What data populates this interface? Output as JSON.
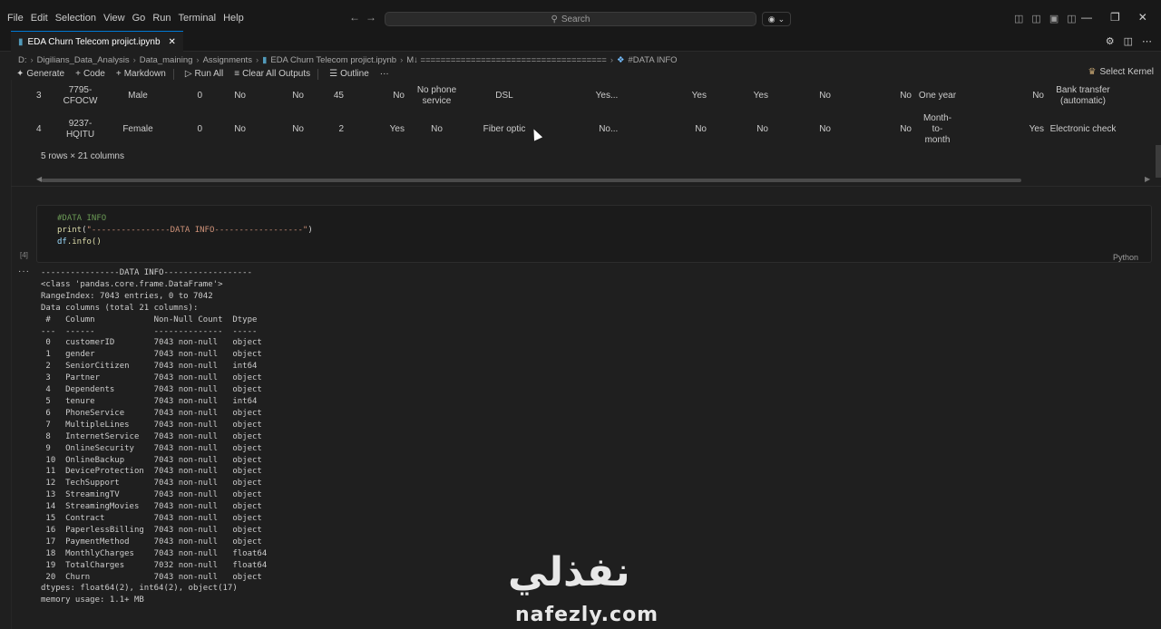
{
  "menu": [
    "File",
    "Edit",
    "Selection",
    "View",
    "Go",
    "Run",
    "Terminal",
    "Help"
  ],
  "search": {
    "placeholder": "Search"
  },
  "tab": {
    "title": "EDA Churn Telecom projict.ipynb"
  },
  "breadcrumb": [
    "D:",
    "Digilians_Data_Analysis",
    "Data_maining",
    "Assignments",
    "EDA Churn Telecom projict.ipynb",
    "M↓ =====================================",
    "#DATA INFO"
  ],
  "toolbar": {
    "generate": "Generate",
    "code": "Code",
    "markdown": "Markdown",
    "run_all": "Run All",
    "clear_outputs": "Clear All Outputs",
    "outline": "Outline",
    "more": "···",
    "select_kernel": "Select Kernel"
  },
  "df_rows": [
    [
      "3",
      "7795-\nCFOCW",
      "Male",
      "0",
      "No",
      "No",
      "45",
      "No",
      "No phone\nservice",
      "DSL",
      "Yes",
      "...",
      "Yes",
      "Yes",
      "No",
      "No",
      "One year",
      "No",
      "Bank transfer\n(automatic)"
    ],
    [
      "4",
      "9237-\nHQITU",
      "Female",
      "0",
      "No",
      "No",
      "2",
      "Yes",
      "No",
      "Fiber optic",
      "No",
      "...",
      "No",
      "No",
      "No",
      "No",
      "Month-\nto-\nmonth",
      "Yes",
      "Electronic check"
    ]
  ],
  "rows_cols": "5 rows × 21 columns",
  "code_cell": {
    "comment": "#DATA INFO",
    "print_fn": "print",
    "print_arg": "\"----------------DATA INFO------------------\"",
    "df_var": "df",
    "info_call": ".info()",
    "language": "Python",
    "exec_count": "[4]"
  },
  "output": {
    "more_icon": "···",
    "text": "----------------DATA INFO------------------\n<class 'pandas.core.frame.DataFrame'>\nRangeIndex: 7043 entries, 0 to 7042\nData columns (total 21 columns):\n #   Column            Non-Null Count  Dtype  \n---  ------            --------------  -----  \n 0   customerID        7043 non-null   object \n 1   gender            7043 non-null   object \n 2   SeniorCitizen     7043 non-null   int64  \n 3   Partner           7043 non-null   object \n 4   Dependents        7043 non-null   object \n 5   tenure            7043 non-null   int64  \n 6   PhoneService      7043 non-null   object \n 7   MultipleLines     7043 non-null   object \n 8   InternetService   7043 non-null   object \n 9   OnlineSecurity    7043 non-null   object \n 10  OnlineBackup      7043 non-null   object \n 11  DeviceProtection  7043 non-null   object \n 12  TechSupport       7043 non-null   object \n 13  StreamingTV       7043 non-null   object \n 14  StreamingMovies   7043 non-null   object \n 15  Contract          7043 non-null   object \n 16  PaperlessBilling  7043 non-null   object \n 17  PaymentMethod     7043 non-null   object \n 18  MonthlyCharges    7043 non-null   float64\n 19  TotalCharges      7032 non-null   float64\n 20  Churn             7043 non-null   object \ndtypes: float64(2), int64(2), object(17)\nmemory usage: 1.1+ MB"
  },
  "watermark": {
    "arabic": "نفذلي",
    "latin": "nafezly.com"
  },
  "colors": {
    "accent": "#0078d4",
    "background": "#1f1f1f",
    "comment": "#6a9955",
    "string": "#ce9178"
  }
}
